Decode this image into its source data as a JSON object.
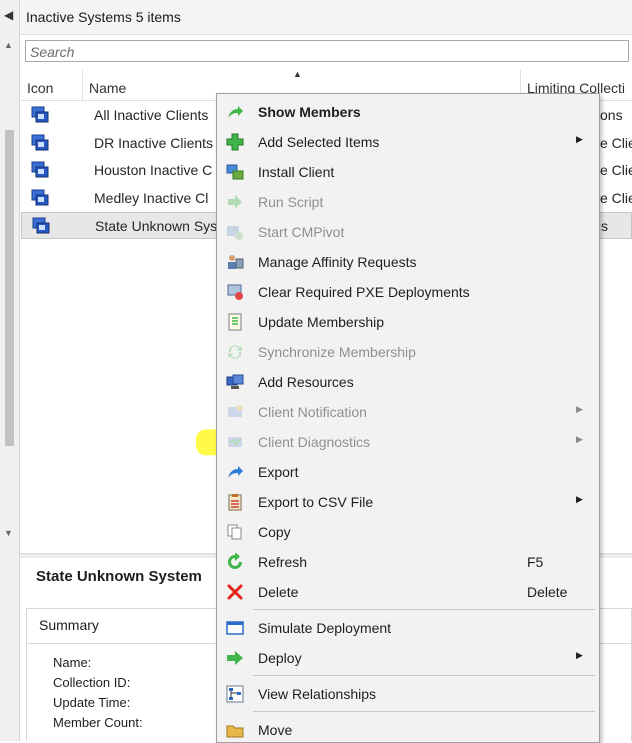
{
  "header": {
    "title": "Inactive Systems 5 items"
  },
  "search": {
    "placeholder": "Search"
  },
  "table": {
    "columns": [
      "Icon",
      "Name",
      "Limiting Collecti"
    ],
    "rows": [
      {
        "name": "All Inactive Clients",
        "limiting": "ons"
      },
      {
        "name": "DR Inactive Clients",
        "limiting": "e Clie"
      },
      {
        "name": "Houston Inactive C",
        "limiting": "e Clie"
      },
      {
        "name": "Medley Inactive Cl",
        "limiting": "e Clie"
      },
      {
        "name": "State Unknown Sys",
        "limiting": "s"
      }
    ]
  },
  "details": {
    "title": "State Unknown System",
    "summary_label": "Summary",
    "fields": [
      "Name:",
      "Collection ID:",
      "Update Time:",
      "Member Count:"
    ]
  },
  "context_menu": {
    "items": [
      {
        "label": "Show Members",
        "icon": "arrow-icon"
      },
      {
        "label": "Add Selected Items",
        "icon": "plus-icon"
      },
      {
        "label": "Install Client",
        "icon": "install-client-icon"
      },
      {
        "label": "Run Script",
        "icon": "run-script-icon"
      },
      {
        "label": "Start CMPivot",
        "icon": "cmpivot-icon"
      },
      {
        "label": "Manage Affinity Requests",
        "icon": "affinity-icon"
      },
      {
        "label": "Clear Required PXE Deployments",
        "icon": "pxe-icon"
      },
      {
        "label": "Update Membership",
        "icon": "update-membership-icon"
      },
      {
        "label": "Synchronize Membership",
        "icon": "sync-icon"
      },
      {
        "label": "Add Resources",
        "icon": "add-resources-icon"
      },
      {
        "label": "Client Notification",
        "icon": "client-notification-icon"
      },
      {
        "label": "Client Diagnostics",
        "icon": "client-diagnostics-icon"
      },
      {
        "label": "Export",
        "icon": "export-icon"
      },
      {
        "label": "Export to CSV File",
        "icon": "export-csv-icon"
      },
      {
        "label": "Copy",
        "icon": "copy-icon"
      },
      {
        "label": "Refresh",
        "icon": "refresh-icon",
        "shortcut": "F5"
      },
      {
        "label": "Delete",
        "icon": "delete-icon",
        "shortcut": "Delete"
      },
      {
        "label": "Simulate Deployment",
        "icon": "simulate-icon"
      },
      {
        "label": "Deploy",
        "icon": "deploy-icon"
      },
      {
        "label": "View Relationships",
        "icon": "relationships-icon"
      },
      {
        "label": "Move",
        "icon": "move-icon"
      }
    ]
  },
  "colors": {
    "highlight": "#fff600",
    "menu_bg": "#f2f2f2",
    "accent_green": "#3fb54a",
    "accent_blue": "#2c7fd6",
    "delete_red": "#e2231a"
  }
}
